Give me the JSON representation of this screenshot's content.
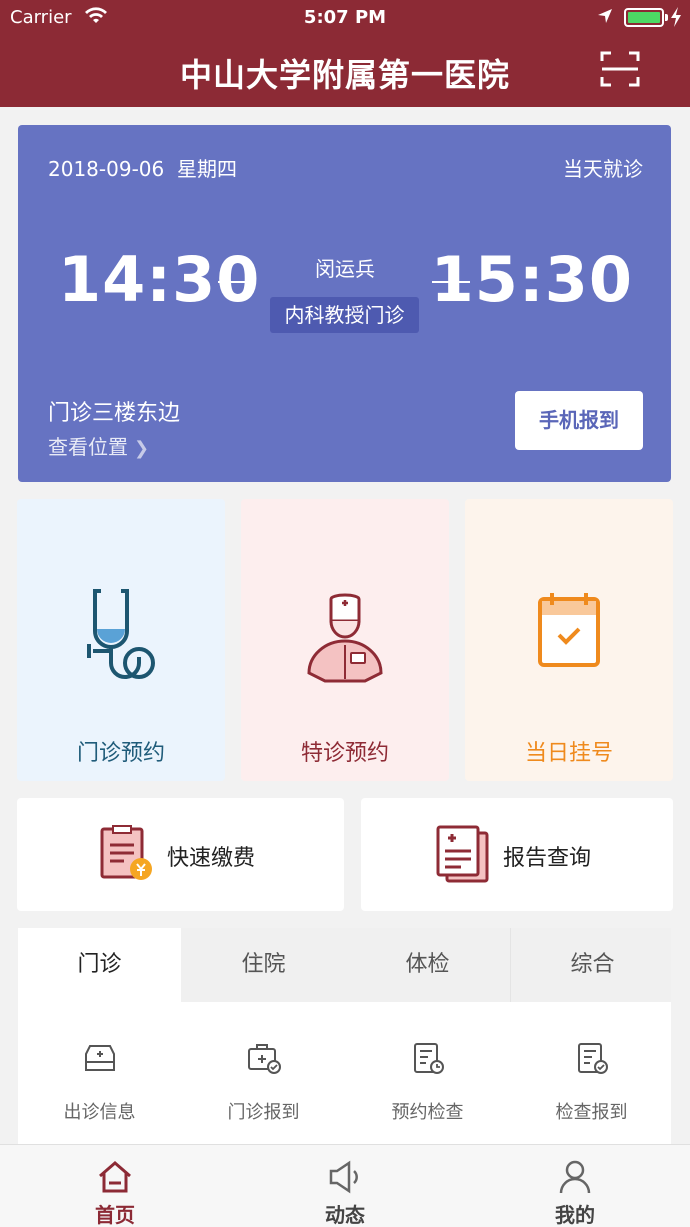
{
  "status_bar": {
    "carrier": "Carrier",
    "time": "5:07 PM",
    "battery_level": 1.0
  },
  "header": {
    "title": "中山大学附属第一医院",
    "scan_icon": "scan-icon"
  },
  "appointment": {
    "date": "2018-09-06",
    "weekday": "星期四",
    "visit_type": "当天就诊",
    "start_time": "14:30",
    "end_time": "15:30",
    "doctor": "闵运兵",
    "department": "内科教授门诊",
    "location": "门诊三楼东边",
    "view_location": "查看位置",
    "checkin_button": "手机报到",
    "card_color": "#6673c2"
  },
  "services": [
    {
      "label": "门诊预约",
      "icon": "stethoscope-icon",
      "color": "#205c7a"
    },
    {
      "label": "特诊预约",
      "icon": "doctor-icon",
      "color": "#8e2b35"
    },
    {
      "label": "当日挂号",
      "icon": "calendar-check-icon",
      "color": "#ef8a1d"
    }
  ],
  "actions": [
    {
      "label": "快速缴费",
      "icon": "bill-payment-icon"
    },
    {
      "label": "报告查询",
      "icon": "report-icon"
    }
  ],
  "tabs": [
    {
      "label": "门诊",
      "active": true
    },
    {
      "label": "住院",
      "active": false
    },
    {
      "label": "体检",
      "active": false
    },
    {
      "label": "综合",
      "active": false
    }
  ],
  "quick_links": [
    {
      "label": "出诊信息",
      "icon": "clinic-info-icon"
    },
    {
      "label": "门诊报到",
      "icon": "clinic-checkin-icon"
    },
    {
      "label": "预约检查",
      "icon": "exam-booking-icon"
    },
    {
      "label": "检查报到",
      "icon": "exam-checkin-icon"
    }
  ],
  "tab_bar": [
    {
      "label": "首页",
      "icon": "home-icon",
      "active": true
    },
    {
      "label": "动态",
      "icon": "megaphone-icon",
      "active": false
    },
    {
      "label": "我的",
      "icon": "user-icon",
      "active": false
    }
  ],
  "brand_color": "#8c2a35"
}
